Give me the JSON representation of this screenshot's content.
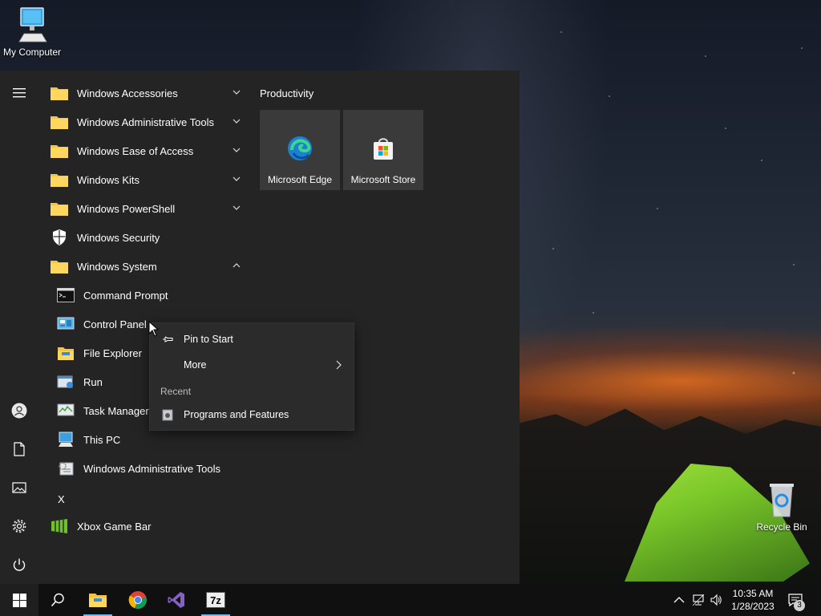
{
  "desktop": {
    "icons": [
      {
        "label": "My Computer",
        "icon": "computer-icon"
      },
      {
        "label": "Recycle Bin",
        "icon": "recycle-bin-icon"
      }
    ]
  },
  "start_menu": {
    "rail": [
      {
        "icon": "hamburger-menu-icon"
      },
      {
        "icon": "user-account-icon"
      },
      {
        "icon": "documents-icon"
      },
      {
        "icon": "pictures-icon"
      },
      {
        "icon": "settings-gear-icon"
      },
      {
        "icon": "power-icon"
      }
    ],
    "apps": [
      {
        "label": "Windows Accessories",
        "icon": "folder-icon",
        "expand": "collapsed"
      },
      {
        "label": "Windows Administrative Tools",
        "icon": "folder-icon",
        "expand": "collapsed"
      },
      {
        "label": "Windows Ease of Access",
        "icon": "folder-icon",
        "expand": "collapsed"
      },
      {
        "label": "Windows Kits",
        "icon": "folder-icon",
        "expand": "collapsed"
      },
      {
        "label": "Windows PowerShell",
        "icon": "folder-icon",
        "expand": "collapsed"
      },
      {
        "label": "Windows Security",
        "icon": "shield-icon"
      },
      {
        "label": "Windows System",
        "icon": "folder-icon",
        "expand": "expanded"
      },
      {
        "label": "Command Prompt",
        "icon": "command-prompt-icon"
      },
      {
        "label": "Control Panel",
        "icon": "control-panel-icon"
      },
      {
        "label": "File Explorer",
        "icon": "file-explorer-icon"
      },
      {
        "label": "Run",
        "icon": "run-icon"
      },
      {
        "label": "Task Manager",
        "icon": "task-manager-icon"
      },
      {
        "label": "This PC",
        "icon": "this-pc-icon"
      },
      {
        "label": "Windows Administrative Tools",
        "icon": "admin-tools-icon"
      }
    ],
    "letter_x": "X",
    "xbox": {
      "label": "Xbox Game Bar",
      "icon": "xbox-game-bar-icon"
    },
    "tiles_group": "Productivity",
    "tiles": [
      {
        "label": "Microsoft Edge",
        "icon": "edge-icon"
      },
      {
        "label": "Microsoft Store",
        "icon": "store-icon"
      }
    ]
  },
  "context_menu": {
    "pin": "Pin to Start",
    "more": "More",
    "recent_header": "Recent",
    "recent_item": "Programs and Features"
  },
  "taskbar": {
    "items": [
      {
        "icon": "windows-start-icon"
      },
      {
        "icon": "search-icon"
      },
      {
        "icon": "file-explorer-icon"
      },
      {
        "icon": "chrome-icon"
      },
      {
        "icon": "visual-studio-icon"
      },
      {
        "icon": "7zip-icon"
      }
    ],
    "tray": {
      "time": "10:35 AM",
      "date": "1/28/2023",
      "notifications": "3"
    }
  },
  "colors": {
    "accent": "#76b9ed",
    "menu_bg": "#242424",
    "tile_bg": "#3a3a3a",
    "folder": "#f6c342"
  }
}
